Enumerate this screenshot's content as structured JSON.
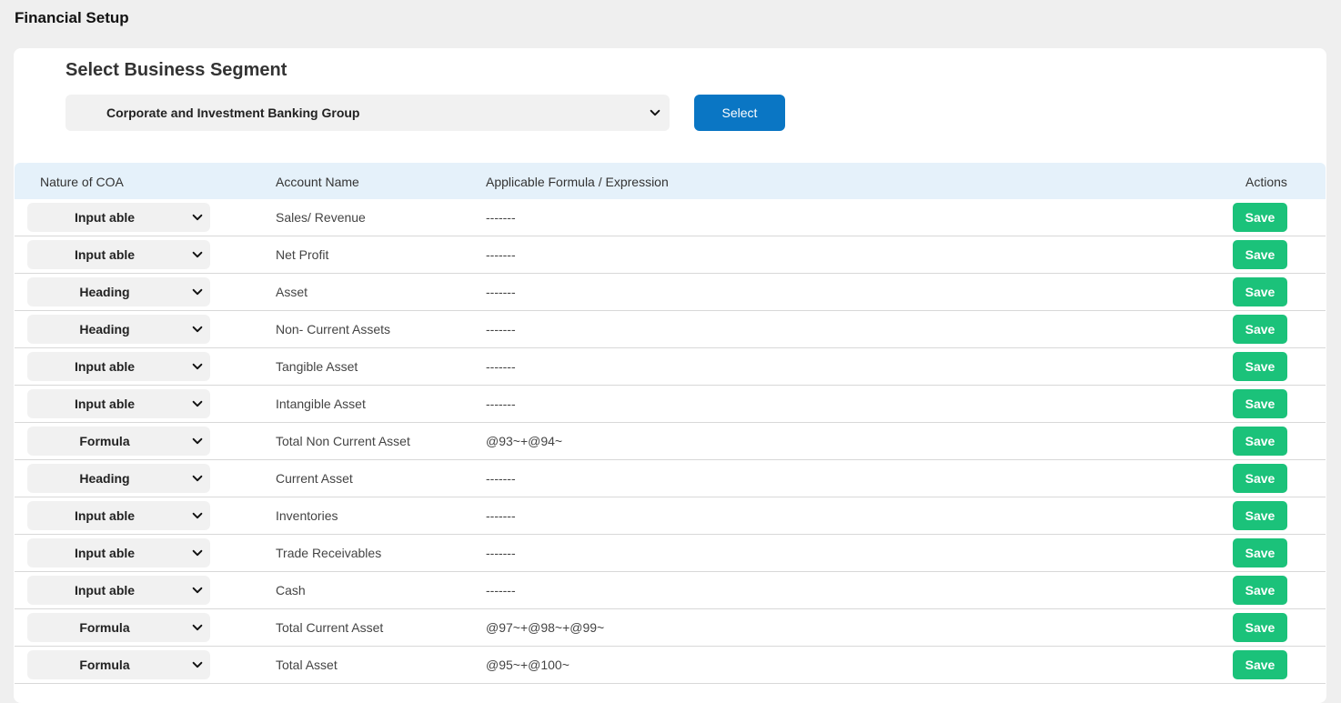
{
  "page": {
    "title": "Financial Setup"
  },
  "segment": {
    "heading": "Select Business Segment",
    "selected": "Corporate and Investment Banking Group",
    "button_label": "Select"
  },
  "table": {
    "headers": {
      "nature": "Nature of COA",
      "account": "Account Name",
      "formula": "Applicable Formula / Expression",
      "actions": "Actions"
    },
    "save_label": "Save",
    "rows": [
      {
        "nature": "Input able",
        "account": "Sales/ Revenue",
        "formula": "-------"
      },
      {
        "nature": "Input able",
        "account": "Net Profit",
        "formula": "-------"
      },
      {
        "nature": "Heading",
        "account": "Asset",
        "formula": "-------"
      },
      {
        "nature": "Heading",
        "account": "Non- Current Assets",
        "formula": "-------"
      },
      {
        "nature": "Input able",
        "account": "Tangible Asset",
        "formula": "-------"
      },
      {
        "nature": "Input able",
        "account": "Intangible Asset",
        "formula": "-------"
      },
      {
        "nature": "Formula",
        "account": "Total Non Current Asset",
        "formula": "@93~+@94~"
      },
      {
        "nature": "Heading",
        "account": "Current Asset",
        "formula": "-------"
      },
      {
        "nature": "Input able",
        "account": "Inventories",
        "formula": "-------"
      },
      {
        "nature": "Input able",
        "account": "Trade Receivables",
        "formula": "-------"
      },
      {
        "nature": "Input able",
        "account": "Cash",
        "formula": "-------"
      },
      {
        "nature": "Formula",
        "account": "Total Current Asset",
        "formula": "@97~+@98~+@99~"
      },
      {
        "nature": "Formula",
        "account": "Total Asset",
        "formula": "@95~+@100~"
      }
    ]
  },
  "colors": {
    "primary_button": "#0a76c4",
    "save_button": "#1bc27a",
    "table_header_bg": "#e5f1fa"
  },
  "icons": {
    "dropdown": "chevron-down-icon"
  }
}
